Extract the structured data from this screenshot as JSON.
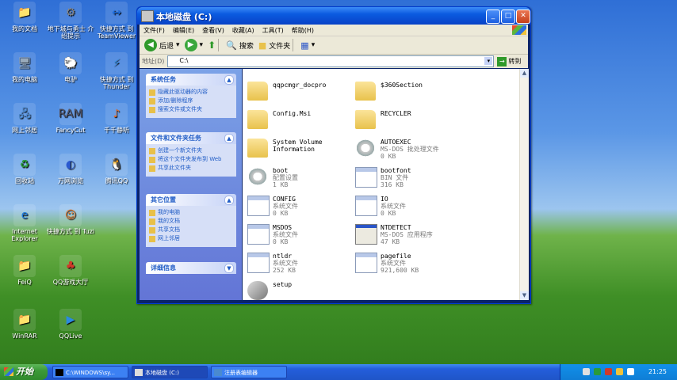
{
  "desktop": {
    "icons": [
      {
        "label": "我的文档",
        "glyph": "📁",
        "color": "#f0c84a"
      },
      {
        "label": "地下城与勇士 介绍提示",
        "glyph": "⚙",
        "color": "#888"
      },
      {
        "label": "快捷方式 到 TeamViewer",
        "glyph": "↔",
        "color": "#1f6fe0"
      },
      {
        "label": "我的电脑",
        "glyph": "🖥",
        "color": "#9ab"
      },
      {
        "label": "电驴",
        "glyph": "🐑",
        "color": "#e07a2a"
      },
      {
        "label": "快捷方式 到 Thunder",
        "glyph": "⚡",
        "color": "#3a8fe0"
      },
      {
        "label": "网上邻居",
        "glyph": "🖧",
        "color": "#4a8ad0"
      },
      {
        "label": "FancyCut",
        "glyph": "RAM",
        "color": "#556"
      },
      {
        "label": "千千静听",
        "glyph": "♪",
        "color": "#e06a2a"
      },
      {
        "label": "回收站",
        "glyph": "♻",
        "color": "#2a9a3a"
      },
      {
        "label": "万网浏览",
        "glyph": "◐",
        "color": "#2a5ad0"
      },
      {
        "label": "腾讯QQ",
        "glyph": "🐧",
        "color": "#222"
      },
      {
        "label": "Internet Explorer",
        "glyph": "e",
        "color": "#1a7ae0"
      },
      {
        "label": "快捷方式 到 Tuzi",
        "glyph": "☺",
        "color": "#e87a2a"
      },
      {
        "label": "FeiQ",
        "glyph": "📁",
        "color": "#f0c84a"
      },
      {
        "label": "QQ游戏大厅",
        "glyph": "♣",
        "color": "#d03a2a"
      },
      {
        "label": "WinRAR",
        "glyph": "📁",
        "color": "#f0c84a"
      },
      {
        "label": "QQLive",
        "glyph": "▶",
        "color": "#2a8ae0"
      }
    ]
  },
  "window": {
    "title": "本地磁盘 (C:)",
    "buttons": {
      "minimize": "_",
      "maximize": "□",
      "close": "✕"
    },
    "menu": [
      "文件(F)",
      "编辑(E)",
      "查看(V)",
      "收藏(A)",
      "工具(T)",
      "帮助(H)"
    ],
    "toolbar": {
      "back": "后退",
      "search": "搜索",
      "folders": "文件夹"
    },
    "address": {
      "label": "地址(D)",
      "value": "C:\\",
      "go": "转到"
    },
    "left_panels": [
      {
        "title": "系统任务",
        "items": [
          "隐藏此驱动器的内容",
          "添加/删除程序",
          "搜索文件或文件夹"
        ]
      },
      {
        "title": "文件和文件夹任务",
        "items": [
          "创建一个新文件夹",
          "将这个文件夹发布到 Web",
          "共享此文件夹"
        ]
      },
      {
        "title": "其它位置",
        "items": [
          "我的电脑",
          "我的文档",
          "共享文档",
          "网上邻居"
        ]
      },
      {
        "title": "详细信息",
        "items": []
      }
    ],
    "files": [
      {
        "name": "qqpcmgr_docpro",
        "type": "",
        "size": "",
        "icon": "folder"
      },
      {
        "name": "$360Section",
        "type": "",
        "size": "",
        "icon": "folder"
      },
      {
        "name": "Config.Msi",
        "type": "",
        "size": "",
        "icon": "folder"
      },
      {
        "name": "RECYCLER",
        "type": "",
        "size": "",
        "icon": "folder"
      },
      {
        "name": "System Volume Information",
        "type": "",
        "size": "",
        "icon": "folder"
      },
      {
        "name": "AUTOEXEC",
        "type": "MS-DOS 批处理文件",
        "size": "0 KB",
        "icon": "gear"
      },
      {
        "name": "boot",
        "type": "配置设置",
        "size": "1 KB",
        "icon": "gear"
      },
      {
        "name": "bootfont",
        "type": "BIN 文件",
        "size": "316 KB",
        "icon": "doc"
      },
      {
        "name": "CONFIG",
        "type": "系统文件",
        "size": "0 KB",
        "icon": "doc"
      },
      {
        "name": "IO",
        "type": "系统文件",
        "size": "0 KB",
        "icon": "doc"
      },
      {
        "name": "MSDOS",
        "type": "系统文件",
        "size": "0 KB",
        "icon": "doc"
      },
      {
        "name": "NTDETECT",
        "type": "MS-DOS 应用程序",
        "size": "47 KB",
        "icon": "dosapp"
      },
      {
        "name": "ntldr",
        "type": "系统文件",
        "size": "252 KB",
        "icon": "doc"
      },
      {
        "name": "pagefile",
        "type": "系统文件",
        "size": "921,600 KB",
        "icon": "doc"
      },
      {
        "name": "setup",
        "type": "",
        "size": "",
        "icon": "setupicon"
      }
    ]
  },
  "taskbar": {
    "start": "开始",
    "tasks": [
      "C:\\WINDOWS\\sy...",
      "本地磁盘 (C:)",
      "注册表编辑器"
    ],
    "active_task": 1,
    "clock": "21:25"
  }
}
